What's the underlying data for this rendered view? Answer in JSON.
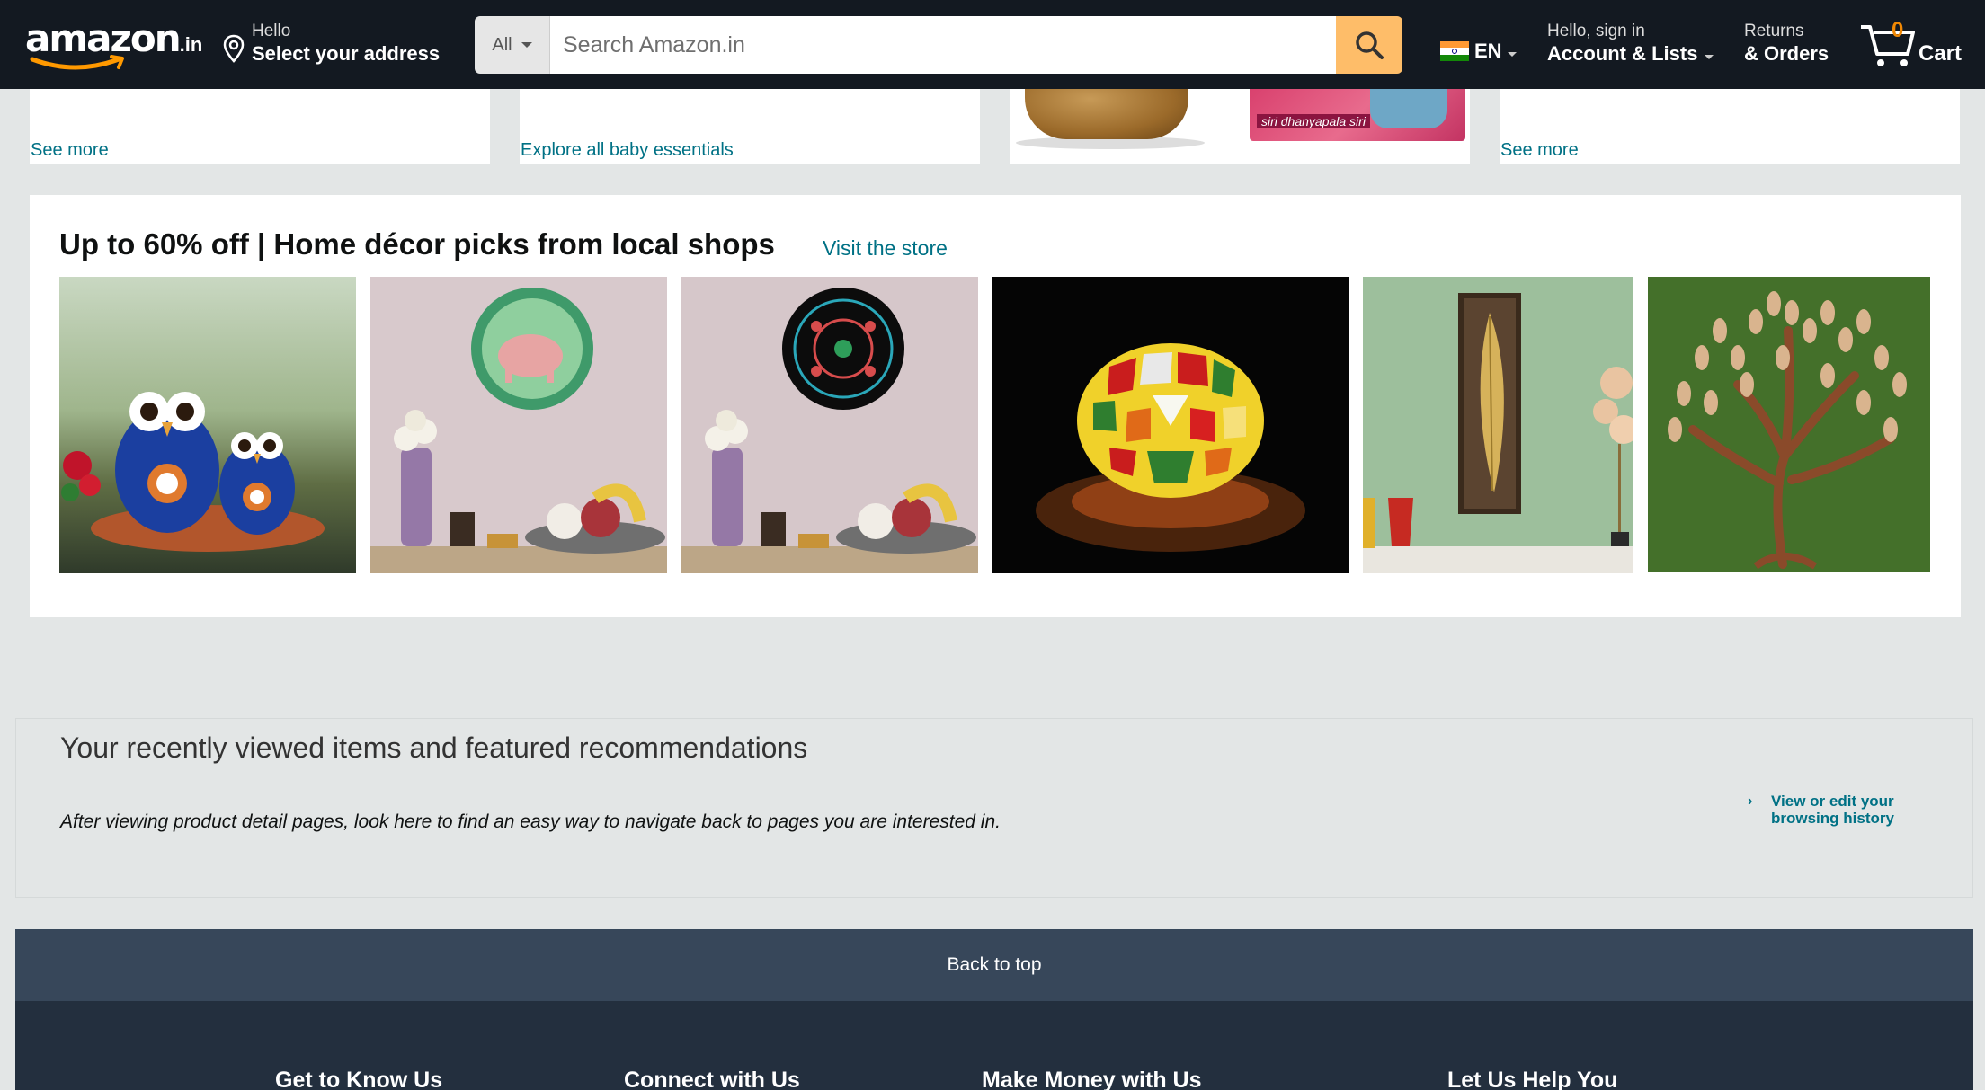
{
  "header": {
    "logo_text": "amazon",
    "logo_tld": ".in",
    "address_hello": "Hello",
    "address_select": "Select your address",
    "search_category": "All",
    "search_placeholder": "Search Amazon.in",
    "language": "EN",
    "account_hello": "Hello, sign in",
    "account_lists": "Account & Lists",
    "returns": "Returns",
    "orders": "& Orders",
    "cart_count": "0",
    "cart_label": "Cart"
  },
  "top_cards": {
    "see_more_1": "See more",
    "baby_link": "Explore all baby essentials",
    "box_label": "siri dhanyapala siri",
    "see_more_2": "See more"
  },
  "decor_card": {
    "title": "Up to 60% off | Home décor picks from local shops",
    "visit_link": "Visit the store"
  },
  "recent": {
    "title": "Your recently viewed items and featured recommendations",
    "description": "After viewing product detail pages, look here to find an easy way to navigate back to pages you are interested in.",
    "history_link": "View or edit your browsing history"
  },
  "footer": {
    "back_to_top": "Back to top",
    "columns": [
      "Get to Know Us",
      "Connect with Us",
      "Make Money with Us",
      "Let Us Help You"
    ]
  },
  "colors": {
    "header_bg": "#131921",
    "search_button": "#febd69",
    "link": "#007185",
    "back_to_top_bg": "#37475a",
    "footer_bg": "#232f3e",
    "cart_count": "#f08804"
  }
}
